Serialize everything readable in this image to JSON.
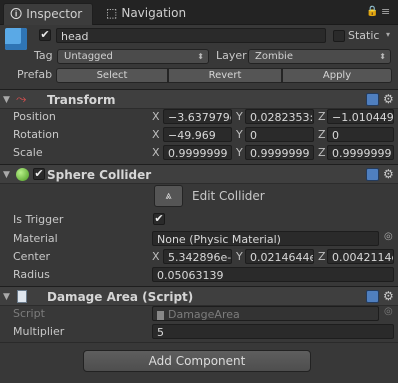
{
  "tabs": [
    {
      "label": "Inspector",
      "icon": "info-icon"
    },
    {
      "label": "Navigation",
      "icon": "navigation-icon"
    }
  ],
  "gameobject": {
    "name": "head",
    "static_label": "Static",
    "tag_label": "Tag",
    "tag_value": "Untagged",
    "layer_label": "Layer",
    "layer_value": "Zombie",
    "prefab_label": "Prefab",
    "select_label": "Select",
    "revert_label": "Revert",
    "apply_label": "Apply"
  },
  "transform": {
    "title": "Transform",
    "position_label": "Position",
    "rotation_label": "Rotation",
    "scale_label": "Scale",
    "x": "X",
    "y": "Y",
    "z": "Z",
    "position": {
      "x": "−3.637979е",
      "y": "0.0282353:",
      "z": "−1.010449е"
    },
    "rotation": {
      "x": "−49.969",
      "y": "0",
      "z": "0"
    },
    "scale": {
      "x": "0.9999999",
      "y": "0.9999999",
      "z": "0.9999999"
    }
  },
  "sphere_collider": {
    "title": "Sphere Collider",
    "edit_label": "Edit Collider",
    "is_trigger_label": "Is Trigger",
    "material_label": "Material",
    "material_value": "None (Physic Material)",
    "center_label": "Center",
    "center": {
      "x": "5.342896e-",
      "y": "0.0214644е",
      "z": "0.0042114с"
    },
    "radius_label": "Radius",
    "radius_value": "0.05063139"
  },
  "damage_area": {
    "title": "Damage Area (Script)",
    "script_label": "Script",
    "script_value": "DamageArea",
    "multiplier_label": "Multiplier",
    "multiplier_value": "5"
  },
  "add_component_label": "Add Component",
  "colors": {
    "background": "#383838",
    "field": "#2a2a2a",
    "header": "#3f3f3f",
    "accent": "#4f7fbf"
  }
}
